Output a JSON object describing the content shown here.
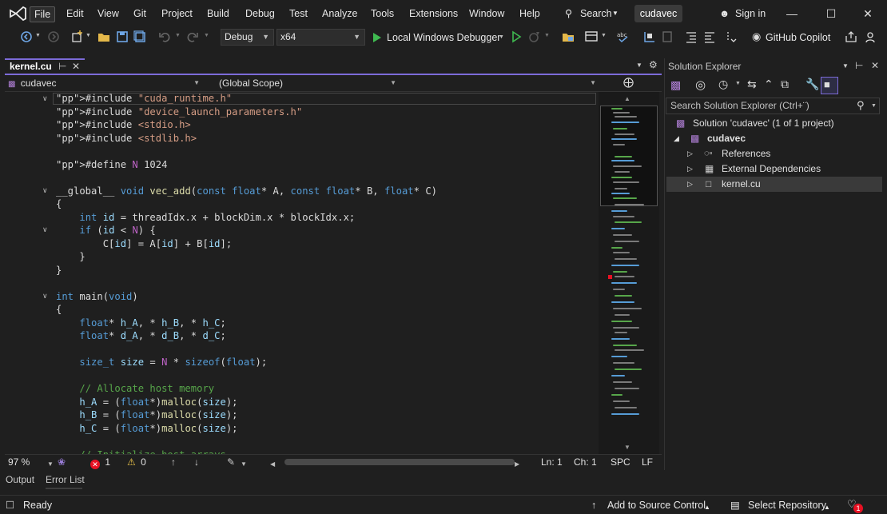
{
  "menu": {
    "items": [
      "File",
      "Edit",
      "View",
      "Git",
      "Project",
      "Build",
      "Debug",
      "Test",
      "Analyze",
      "Tools",
      "Extensions",
      "Window",
      "Help"
    ],
    "search_label": "Search",
    "solution_name": "cudavec",
    "sign_in": "Sign in"
  },
  "toolbar": {
    "configuration": "Debug",
    "platform": "x64",
    "run_label": "Local Windows Debugger",
    "copilot_label": "GitHub Copilot"
  },
  "editor": {
    "tab_title": "kernel.cu",
    "nav_project": "cudavec",
    "nav_scope": "(Global Scope)",
    "nav_member": "",
    "code_lines": [
      "#include \"cuda_runtime.h\"",
      "#include \"device_launch_parameters.h\"",
      "#include <stdio.h>",
      "#include <stdlib.h>",
      "",
      "#define N 1024",
      "",
      "__global__ void vec_add(const float* A, const float* B, float* C)",
      "{",
      "    int id = threadIdx.x + blockDim.x * blockIdx.x;",
      "    if (id < N) {",
      "        C[id] = A[id] + B[id];",
      "    }",
      "}",
      "",
      "int main(void)",
      "{",
      "    float* h_A, * h_B, * h_C;",
      "    float* d_A, * d_B, * d_C;",
      "",
      "    size_t size = N * sizeof(float);",
      "",
      "    // Allocate host memory",
      "    h_A = (float*)malloc(size);",
      "    h_B = (float*)malloc(size);",
      "    h_C = (float*)malloc(size);",
      "",
      "    // Initialize host arrays"
    ],
    "status": {
      "zoom": "97 %",
      "errors": "1",
      "warnings": "0",
      "line": "Ln: 1",
      "col": "Ch: 1",
      "whitespace": "SPC",
      "line_ending": "LF"
    }
  },
  "bottom_tabs": [
    "Output",
    "Error List"
  ],
  "solution_explorer": {
    "title": "Solution Explorer",
    "search_placeholder": "Search Solution Explorer (Ctrl+¨)",
    "solution_label": "Solution 'cudavec' (1 of 1 project)",
    "project": "cudavec",
    "nodes": [
      "References",
      "External Dependencies",
      "kernel.cu"
    ]
  },
  "statusbar": {
    "ready": "Ready",
    "source_control": "Add to Source Control",
    "repository": "Select Repository",
    "notifications": "1"
  },
  "colors": {
    "accent": "#7c6bd8",
    "background": "#1f1f1f",
    "keyword": "#569cd6",
    "string": "#d69d85",
    "comment": "#57a64a",
    "error": "#e81123"
  }
}
